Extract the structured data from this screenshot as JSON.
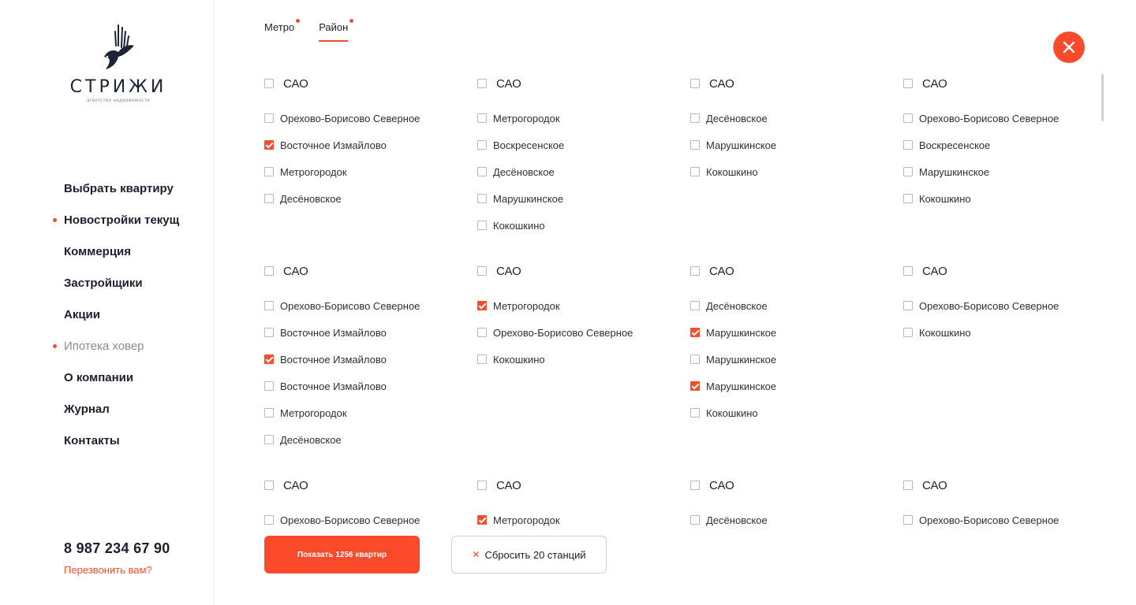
{
  "logo": {
    "name": "СТРИЖИ",
    "tagline": "агентство недвижимости"
  },
  "nav": [
    {
      "label": "Выбрать квартиру",
      "dot": false,
      "muted": false
    },
    {
      "label": "Новостройки текущ",
      "dot": true,
      "muted": false
    },
    {
      "label": "Коммерция",
      "dot": false,
      "muted": false
    },
    {
      "label": "Застройщики",
      "dot": false,
      "muted": false
    },
    {
      "label": "Акции",
      "dot": false,
      "muted": false
    },
    {
      "label": "Ипотека ховер",
      "dot": true,
      "muted": true
    },
    {
      "label": "О компании",
      "dot": false,
      "muted": false
    },
    {
      "label": "Журнал",
      "dot": false,
      "muted": false
    },
    {
      "label": "Контакты",
      "dot": false,
      "muted": false
    }
  ],
  "contact": {
    "phone": "8 987 234 67 90",
    "callback": "Перезвонить вам?"
  },
  "tabs": [
    {
      "label": "Метро",
      "active": false
    },
    {
      "label": "Район",
      "active": true
    }
  ],
  "accent_color": "#fb4b2b",
  "groups": [
    {
      "title": "САО",
      "checked": false,
      "items": [
        {
          "label": "Орехово-Борисово Северное",
          "checked": false
        },
        {
          "label": "Восточное Измайлово",
          "checked": true
        },
        {
          "label": "Метрогородок",
          "checked": false
        },
        {
          "label": "Десёновское",
          "checked": false
        }
      ]
    },
    {
      "title": "САО",
      "checked": false,
      "items": [
        {
          "label": "Метрогородок",
          "checked": false
        },
        {
          "label": "Воскресенское",
          "checked": false
        },
        {
          "label": "Десёновское",
          "checked": false
        },
        {
          "label": "Марушкинское",
          "checked": false
        },
        {
          "label": "Кокошкино",
          "checked": false
        }
      ]
    },
    {
      "title": "САО",
      "checked": false,
      "items": [
        {
          "label": "Десёновское",
          "checked": false
        },
        {
          "label": "Марушкинское",
          "checked": false
        },
        {
          "label": "Кокошкино",
          "checked": false
        }
      ]
    },
    {
      "title": "САО",
      "checked": false,
      "items": [
        {
          "label": "Орехово-Борисово Северное",
          "checked": false
        },
        {
          "label": "Воскресенское",
          "checked": false
        },
        {
          "label": "Марушкинское",
          "checked": false
        },
        {
          "label": "Кокошкино",
          "checked": false
        }
      ]
    },
    {
      "title": "САО",
      "checked": false,
      "items": [
        {
          "label": "Орехово-Борисово Северное",
          "checked": false
        },
        {
          "label": "Восточное Измайлово",
          "checked": false
        },
        {
          "label": "Восточное Измайлово",
          "checked": true
        },
        {
          "label": "Восточное Измайлово",
          "checked": false
        },
        {
          "label": "Метрогородок",
          "checked": false
        },
        {
          "label": "Десёновское",
          "checked": false
        }
      ]
    },
    {
      "title": "САО",
      "checked": false,
      "items": [
        {
          "label": "Метрогородок",
          "checked": true
        },
        {
          "label": "Орехово-Борисово Северное",
          "checked": false
        },
        {
          "label": "Кокошкино",
          "checked": false
        }
      ]
    },
    {
      "title": "САО",
      "checked": false,
      "items": [
        {
          "label": "Десёновское",
          "checked": false
        },
        {
          "label": "Марушкинское",
          "checked": true
        },
        {
          "label": "Марушкинское",
          "checked": false
        },
        {
          "label": "Марушкинское",
          "checked": true
        },
        {
          "label": "Кокошкино",
          "checked": false
        }
      ]
    },
    {
      "title": "САО",
      "checked": false,
      "items": [
        {
          "label": "Орехово-Борисово Северное",
          "checked": false
        },
        {
          "label": "Кокошкино",
          "checked": false
        }
      ]
    },
    {
      "title": "САО",
      "checked": false,
      "items": [
        {
          "label": "Орехово-Борисово Северное",
          "checked": false
        }
      ]
    },
    {
      "title": "САО",
      "checked": false,
      "items": [
        {
          "label": "Метрогородок",
          "checked": true
        }
      ]
    },
    {
      "title": "САО",
      "checked": false,
      "items": [
        {
          "label": "Десёновское",
          "checked": false
        }
      ]
    },
    {
      "title": "САО",
      "checked": false,
      "items": [
        {
          "label": "Орехово-Борисово Северное",
          "checked": false
        }
      ]
    }
  ],
  "buttons": {
    "show": "Показать 1256 квартир",
    "reset": "Сбросить 20 станций"
  }
}
